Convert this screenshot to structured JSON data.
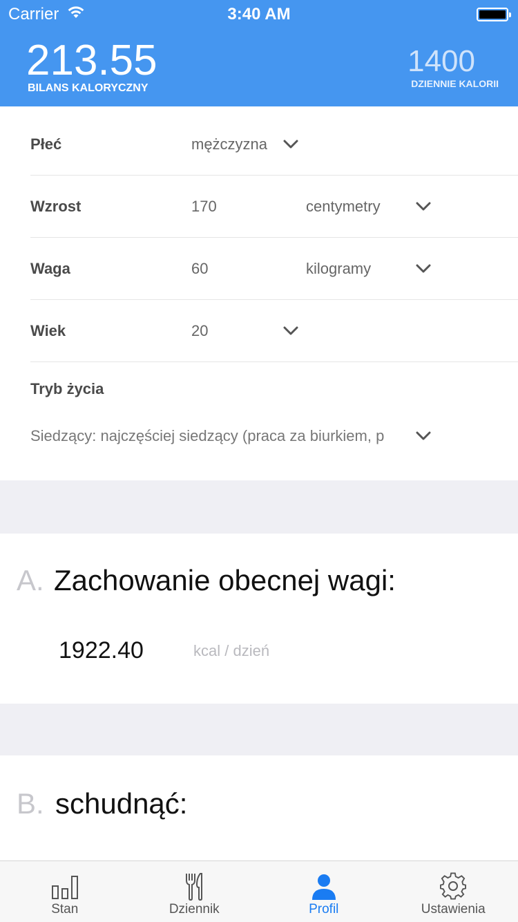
{
  "status": {
    "carrier": "Carrier",
    "time": "3:40 AM"
  },
  "header": {
    "balance_value": "213.55",
    "balance_label": "BILANS KALORYCZNY",
    "daily_value": "1400",
    "daily_label": "DZIENNIE KALORII",
    "color": "#4596f0"
  },
  "form": {
    "gender": {
      "label": "Płeć",
      "value": "mężczyzna"
    },
    "height": {
      "label": "Wzrost",
      "value": "170",
      "unit": "centymetry"
    },
    "weight": {
      "label": "Waga",
      "value": "60",
      "unit": "kilogramy"
    },
    "age": {
      "label": "Wiek",
      "value": "20"
    },
    "lifestyle": {
      "label": "Tryb życia",
      "value": "Siedzący: najczęściej siedzący (praca za biurkiem, p"
    }
  },
  "sections": {
    "a": {
      "letter": "A.",
      "heading": "Zachowanie obecnej wagi:",
      "value": "1922.40",
      "unit": "kcal / dzień"
    },
    "b": {
      "letter": "B.",
      "heading": "schudnąć:"
    }
  },
  "tabbar": {
    "active_color": "#1a7cf2",
    "tabs": [
      {
        "label": "Stan",
        "icon": "bar-chart-icon"
      },
      {
        "label": "Dziennik",
        "icon": "fork-knife-icon"
      },
      {
        "label": "Profil",
        "icon": "person-icon"
      },
      {
        "label": "Ustawienia",
        "icon": "gear-icon"
      }
    ],
    "active_index": 2
  }
}
